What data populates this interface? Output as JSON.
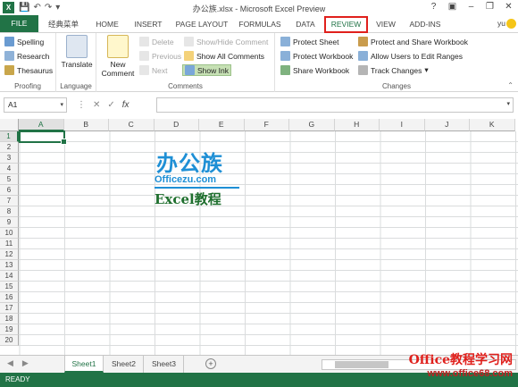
{
  "app": {
    "title": "办公族.xlsx - Microsoft Excel Preview",
    "user": "yu"
  },
  "tabs": [
    "FILE",
    "经典菜单",
    "HOME",
    "INSERT",
    "PAGE LAYOUT",
    "FORMULAS",
    "DATA",
    "REVIEW",
    "VIEW",
    "ADD-INS"
  ],
  "ribbon": {
    "proofing": {
      "label": "Proofing",
      "spelling": "Spelling",
      "research": "Research",
      "thesaurus": "Thesaurus"
    },
    "language": {
      "label": "Language",
      "translate": "Translate"
    },
    "comments": {
      "label": "Comments",
      "new_comment_1": "New",
      "new_comment_2": "Comment",
      "delete": "Delete",
      "previous": "Previous",
      "next": "Next",
      "show_hide": "Show/Hide Comment",
      "show_all": "Show All Comments",
      "show_ink": "Show Ink"
    },
    "changes": {
      "label": "Changes",
      "protect_sheet": "Protect Sheet",
      "protect_workbook": "Protect Workbook",
      "share_workbook": "Share Workbook",
      "protect_share": "Protect and Share Workbook",
      "allow_users": "Allow Users to Edit Ranges",
      "track_changes": "Track Changes"
    }
  },
  "formula_bar": {
    "name_box": "A1",
    "fx": "fx",
    "value": ""
  },
  "columns": [
    "A",
    "B",
    "C",
    "D",
    "E",
    "F",
    "G",
    "H",
    "I",
    "J",
    "K"
  ],
  "rows": [
    "1",
    "2",
    "3",
    "4",
    "5",
    "6",
    "7",
    "8",
    "9",
    "10",
    "11",
    "12",
    "13",
    "14",
    "15",
    "16",
    "17",
    "18",
    "19",
    "20"
  ],
  "watermark": {
    "cn": "办公族",
    "domain": "Officezu.com",
    "excel": "Excel教程"
  },
  "sheets": [
    "Sheet1",
    "Sheet2",
    "Sheet3"
  ],
  "status": {
    "ready": "READY"
  },
  "footer_watermark": {
    "line1": "Office教程学习网",
    "line2": "www.office68.com"
  },
  "colors": {
    "accent": "#217346",
    "highlight": "#e0201c"
  }
}
